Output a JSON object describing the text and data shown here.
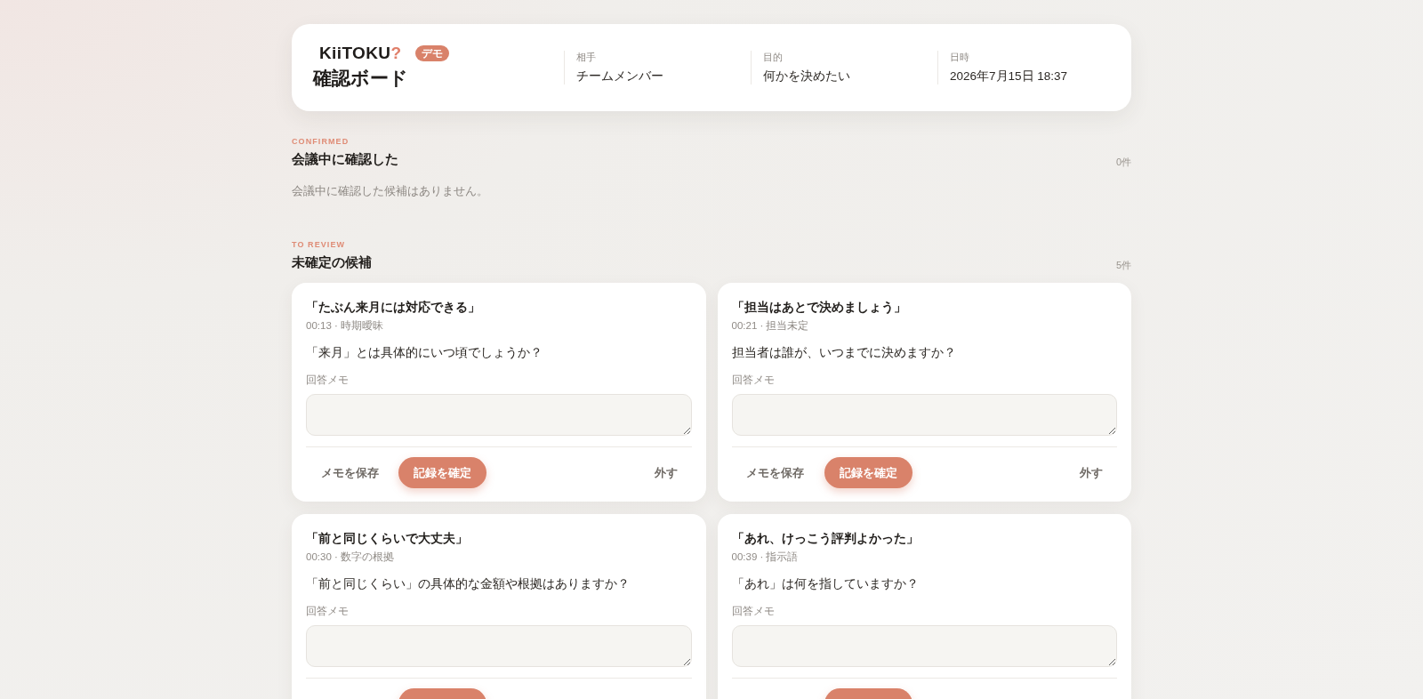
{
  "header": {
    "logo": {
      "text": "KiiTOKU",
      "accent": "?"
    },
    "badge": "デモ",
    "title": "確認ボード",
    "fields": [
      {
        "label": "相手",
        "value": "チームメンバー"
      },
      {
        "label": "目的",
        "value": "何かを決めたい"
      },
      {
        "label": "日時",
        "value": "2026年7月15日 18:37"
      }
    ]
  },
  "sections": [
    {
      "eyebrow": "CONFIRMED",
      "title": "会議中に確認した",
      "count": "0件",
      "empty_message": "会議中に確認した候補はありません。"
    },
    {
      "eyebrow": "TO REVIEW",
      "title": "未確定の候補",
      "count": "5件",
      "cards": [
        {
          "quote": "「たぶん来月には対応できる」",
          "meta": "00:13 · 時期曖昧",
          "question": "「来月」とは具体的にいつ頃でしょうか？",
          "memo_label": "回答メモ",
          "actions": [
            {
              "kind": "save",
              "label": "メモを保存"
            },
            {
              "kind": "confirm",
              "label": "記録を確定"
            },
            {
              "kind": "remove",
              "label": "外す"
            }
          ]
        },
        {
          "quote": "「担当はあとで決めましょう」",
          "meta": "00:21 · 担当未定",
          "question": "担当者は誰が、いつまでに決めますか？",
          "memo_label": "回答メモ",
          "actions": [
            {
              "kind": "save",
              "label": "メモを保存"
            },
            {
              "kind": "confirm",
              "label": "記録を確定"
            },
            {
              "kind": "remove",
              "label": "外す"
            }
          ]
        },
        {
          "quote": "「前と同じくらいで大丈夫」",
          "meta": "00:30 · 数字の根拠",
          "question": "「前と同じくらい」の具体的な金額や根拠はありますか？",
          "memo_label": "回答メモ",
          "actions": [
            {
              "kind": "confirm"
            }
          ]
        },
        {
          "quote": "「あれ、けっこう評判よかった」",
          "meta": "00:39 · 指示語",
          "question": "「あれ」は何を指していますか？",
          "memo_label": "回答メモ",
          "actions": [
            {
              "kind": "confirm"
            }
          ]
        }
      ]
    }
  ]
}
